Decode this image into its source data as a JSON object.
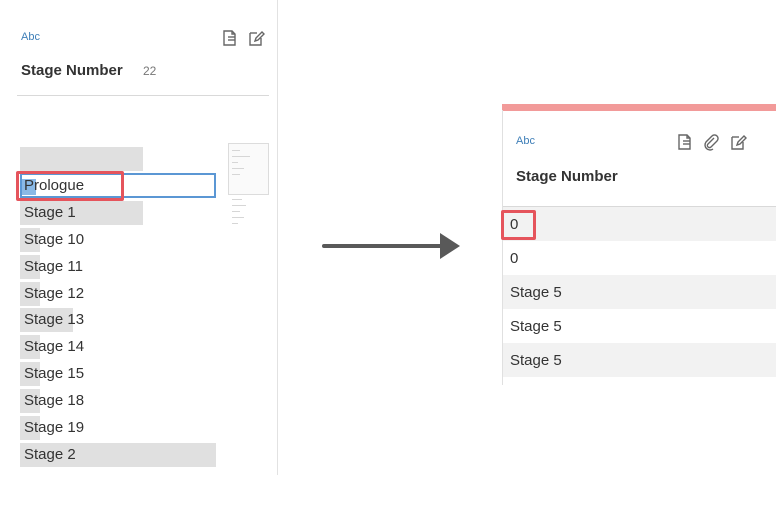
{
  "left_panel": {
    "type_label": "Abc",
    "field_name": "Stage Number",
    "field_count": "22",
    "icons": [
      "profile-options-icon",
      "edit-icon"
    ],
    "values": [
      {
        "label": "",
        "bar": 0.63
      },
      {
        "label": "Prologue",
        "bar": 0.07,
        "selected": true
      },
      {
        "label": "Stage 1",
        "bar": 0.63
      },
      {
        "label": "Stage 10",
        "bar": 0.1
      },
      {
        "label": "Stage 11",
        "bar": 0.1
      },
      {
        "label": "Stage 12",
        "bar": 0.1
      },
      {
        "label": "Stage 13",
        "bar": 0.27
      },
      {
        "label": "Stage 14",
        "bar": 0.1
      },
      {
        "label": "Stage 15",
        "bar": 0.1
      },
      {
        "label": "Stage 18",
        "bar": 0.1
      },
      {
        "label": "Stage 19",
        "bar": 0.1
      },
      {
        "label": "Stage 2",
        "bar": 1.0
      }
    ]
  },
  "right_panel": {
    "type_label": "Abc",
    "field_name": "Stage Number",
    "icons": [
      "profile-options-icon",
      "attach-icon",
      "edit-icon"
    ],
    "cells": [
      "0",
      "0",
      "Stage 5",
      "Stage 5",
      "Stage 5"
    ],
    "accent_color": "#f29a99"
  },
  "colors": {
    "callout": "#e5545c",
    "selection": "#5b97d4",
    "bar": "#e0e0e0",
    "arrow": "#595959",
    "type_label": "#3f7fb8"
  }
}
